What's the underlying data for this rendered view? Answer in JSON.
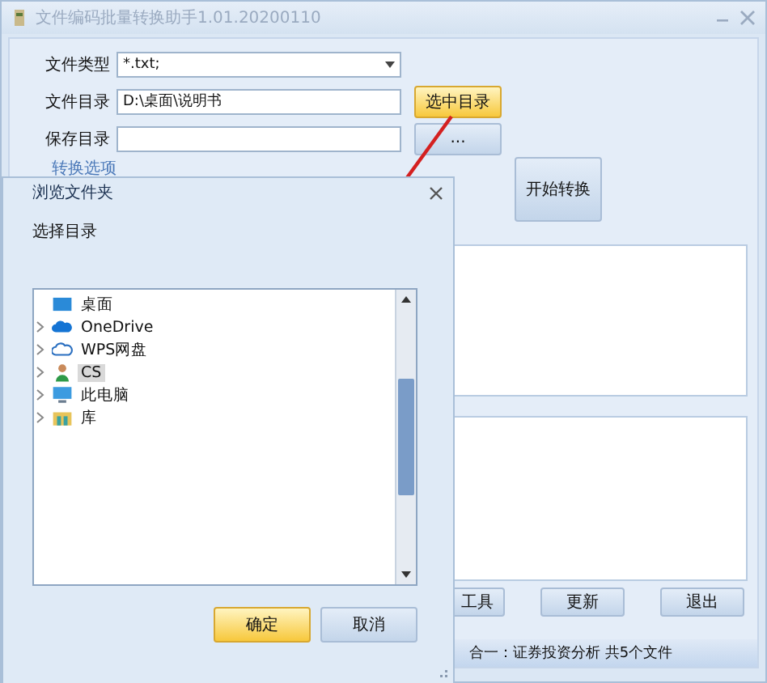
{
  "window": {
    "title": "文件编码批量转换助手1.01.20200110"
  },
  "form": [
    {
      "kind": "dropdown",
      "label": "文件类型",
      "value": "*.txt;"
    },
    {
      "kind": "field",
      "label": "文件目录",
      "value": "D:\\桌面\\说明书",
      "button": "选中目录",
      "button_highlight": true
    },
    {
      "kind": "field",
      "label": "保存目录",
      "button": "...",
      "button_highlight": false
    }
  ],
  "options_group": {
    "title": "转换选项"
  },
  "start_button": "开始转换",
  "bottom_buttons": [
    "工具",
    "更新",
    "退出"
  ],
  "status_bar": "合一：证券投资分析 共5个文件",
  "dialog": {
    "title": "浏览文件夹",
    "prompt": "选择目录",
    "tree": [
      {
        "label": "桌面",
        "kind": "desktop",
        "expandable": false
      },
      {
        "label": "OneDrive",
        "kind": "cloud",
        "expandable": true,
        "selected": false
      },
      {
        "label": "WPS网盘",
        "kind": "cloud-outline",
        "expandable": true,
        "selected": false
      },
      {
        "label": "CS",
        "kind": "user",
        "expandable": true,
        "selected": true
      },
      {
        "label": "此电脑",
        "kind": "computer",
        "expandable": true,
        "selected": false
      },
      {
        "label": "库",
        "kind": "library",
        "expandable": true,
        "selected": false
      }
    ],
    "scroll": {
      "level": 0.45
    },
    "buttons": [
      {
        "label": "确定",
        "primary": true
      },
      {
        "label": "取消",
        "primary": false
      }
    ]
  }
}
